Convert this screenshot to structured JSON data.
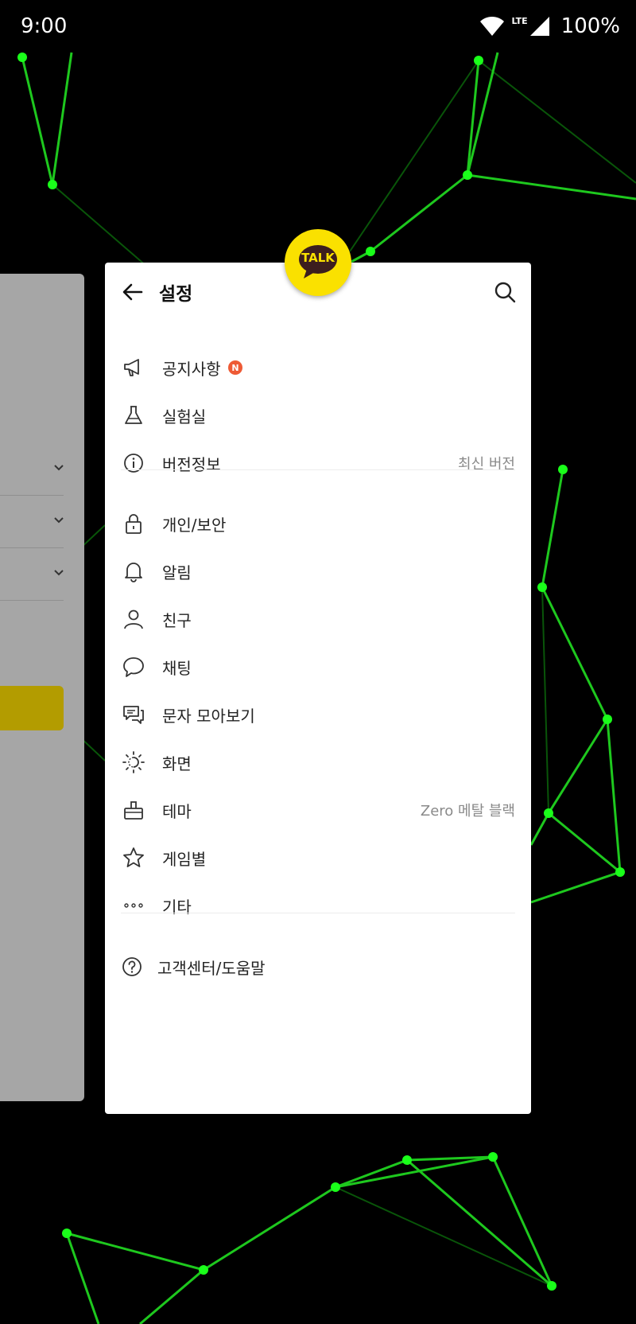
{
  "status": {
    "time": "9:00",
    "network": "LTE",
    "battery": "100%"
  },
  "logo": {
    "text": "TALK"
  },
  "header": {
    "title": "설정",
    "back_icon": "arrow-left-icon",
    "search_icon": "search-icon"
  },
  "menu": [
    {
      "id": "notice",
      "label": "공지사항",
      "icon": "megaphone-icon",
      "badge": "N",
      "sub": ""
    },
    {
      "id": "lab",
      "label": "실험실",
      "icon": "flask-icon",
      "sub": ""
    },
    {
      "id": "version",
      "label": "버전정보",
      "icon": "info-icon",
      "sub": "최신 버전"
    },
    {
      "id": "privacy",
      "label": "개인/보안",
      "icon": "lock-icon",
      "sub": ""
    },
    {
      "id": "notifications",
      "label": "알림",
      "icon": "bell-icon",
      "sub": ""
    },
    {
      "id": "friends",
      "label": "친구",
      "icon": "person-icon",
      "sub": ""
    },
    {
      "id": "chatting",
      "label": "채팅",
      "icon": "chat-bubble-icon",
      "sub": ""
    },
    {
      "id": "sms",
      "label": "문자 모아보기",
      "icon": "message-stack-icon",
      "sub": ""
    },
    {
      "id": "display",
      "label": "화면",
      "icon": "brightness-icon",
      "sub": ""
    },
    {
      "id": "theme",
      "label": "테마",
      "icon": "paint-brush-icon",
      "sub": "Zero 메탈 블랙"
    },
    {
      "id": "game",
      "label": "게임별",
      "icon": "star-icon",
      "sub": ""
    },
    {
      "id": "etc",
      "label": "기타",
      "icon": "more-dots-icon",
      "sub": ""
    }
  ],
  "help": {
    "label": "고객센터/도움말",
    "icon": "help-circle-icon"
  },
  "colors": {
    "accent": "#fae100",
    "badge": "#ee5a35",
    "network_lines": "#00e000"
  }
}
